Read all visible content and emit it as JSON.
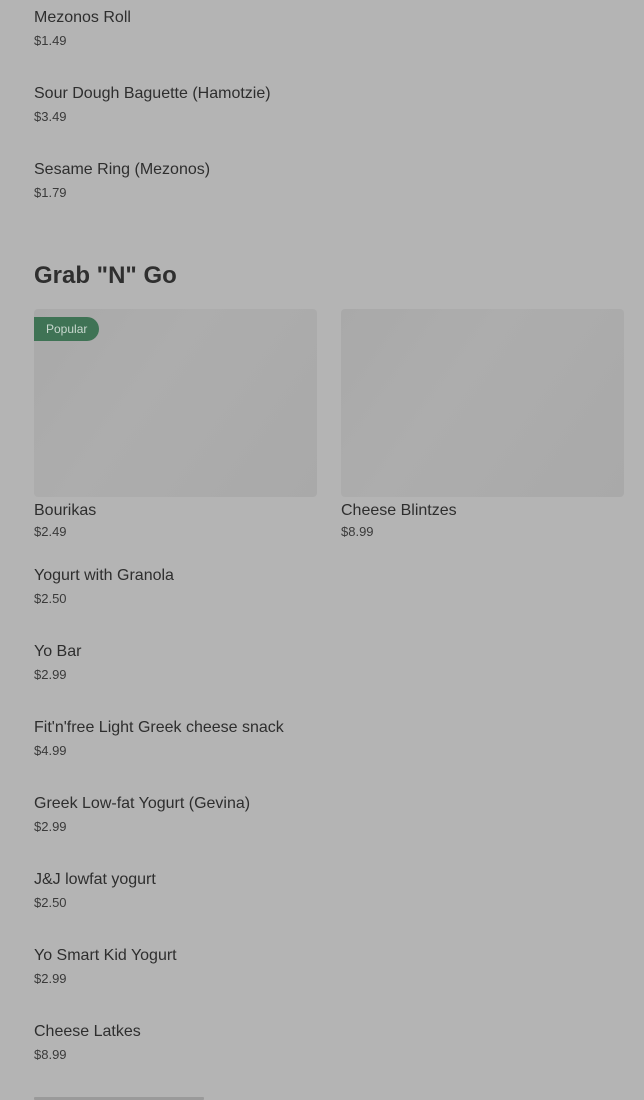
{
  "top_items": [
    {
      "name": "Mezonos Roll",
      "price": "$1.49"
    },
    {
      "name": "Sour Dough Baguette (Hamotzie)",
      "price": "$3.49"
    },
    {
      "name": "Sesame Ring (Mezonos)",
      "price": "$1.79"
    }
  ],
  "section": {
    "title": "Grab \"N\" Go",
    "cards": [
      {
        "name": "Bourikas",
        "price": "$2.49",
        "badge": "Popular"
      },
      {
        "name": "Cheese Blintzes",
        "price": "$8.99"
      }
    ],
    "items": [
      {
        "name": "Yogurt with Granola",
        "price": "$2.50"
      },
      {
        "name": "Yo Bar",
        "price": "$2.99"
      },
      {
        "name": "Fit'n'free Light Greek cheese snack",
        "price": "$4.99"
      },
      {
        "name": "Greek Low-fat Yogurt (Gevina)",
        "price": "$2.99"
      },
      {
        "name": "J&J lowfat yogurt",
        "price": "$2.50"
      },
      {
        "name": "Yo Smart Kid Yogurt",
        "price": "$2.99"
      },
      {
        "name": "Cheese Latkes",
        "price": "$8.99"
      }
    ]
  },
  "colors": {
    "background": "#b4b4b4",
    "badge": "#3f7355"
  }
}
